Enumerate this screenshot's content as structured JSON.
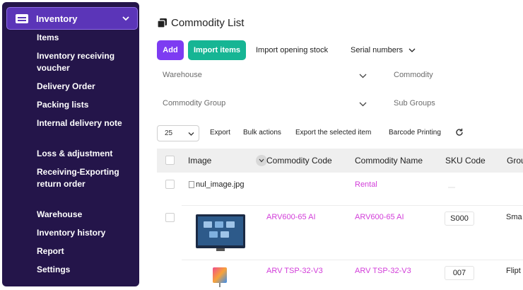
{
  "sidebar": {
    "header": "Inventory",
    "items": [
      {
        "label": "Items"
      },
      {
        "label": "Inventory receiving voucher"
      },
      {
        "label": "Delivery Order"
      },
      {
        "label": "Packing lists"
      },
      {
        "label": "Internal delivery note"
      },
      {
        "label": "Loss & adjustment"
      },
      {
        "label": "Receiving-Exporting return order"
      },
      {
        "label": "Warehouse"
      },
      {
        "label": "Inventory history"
      },
      {
        "label": "Report"
      },
      {
        "label": "Settings"
      }
    ]
  },
  "page": {
    "title": "Commodity List",
    "buttons": {
      "add": "Add",
      "import_items": "Import items",
      "import_opening_stock": "Import opening stock",
      "serial_numbers": "Serial numbers"
    },
    "filters": {
      "warehouse": "Warehouse",
      "commodity": "Commodity",
      "commodity_group": "Commodity Group",
      "sub_groups": "Sub Groups"
    },
    "toolbar": {
      "per_page": "25",
      "export": "Export",
      "bulk_actions": "Bulk actions",
      "export_selected": "Export the selected item",
      "barcode_printing": "Barcode Printing"
    }
  },
  "table": {
    "columns": [
      "Image",
      "Commodity Code",
      "Commodity Name",
      "SKU Code",
      "Grou"
    ],
    "rows": [
      {
        "image_alt": "nul_image.jpg",
        "code": "",
        "name": "Rental",
        "sku": "",
        "group": ""
      },
      {
        "image_alt": "",
        "code": "ARV600-65 AI",
        "name": "ARV600-65 AI",
        "sku": "S000",
        "group": "Sma"
      },
      {
        "image_alt": "",
        "code": "ARV TSP-32-V3",
        "name": "ARV TSP-32-V3",
        "sku": "007",
        "group": "Flipt"
      }
    ]
  },
  "colors": {
    "sidebar_bg": "#24154a",
    "sidebar_active": "#5b35b8",
    "add_button": "#7d3cf2",
    "import_button": "#16b594",
    "link_pink": "#d23dd9"
  }
}
